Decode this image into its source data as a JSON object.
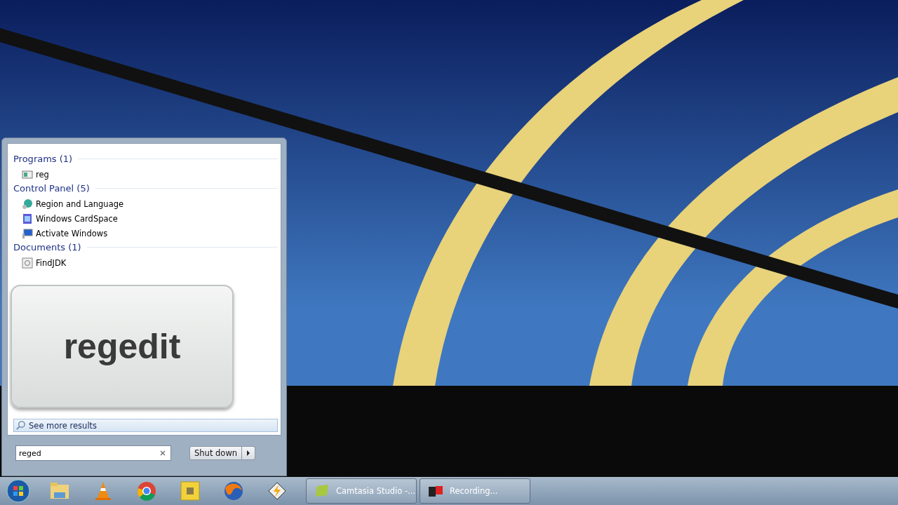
{
  "start_menu": {
    "groups": [
      {
        "heading": "Programs (1)",
        "items": [
          {
            "label": "reg",
            "kind": "program"
          }
        ]
      },
      {
        "heading": "Control Panel (5)",
        "items": [
          {
            "label": "Region and Language",
            "kind": "globe"
          },
          {
            "label": "Windows CardSpace",
            "kind": "card"
          },
          {
            "label": "Activate Windows",
            "kind": "monitor"
          }
        ]
      },
      {
        "heading": "Documents (1)",
        "items": [
          {
            "label": "FindJDK",
            "kind": "document"
          }
        ]
      }
    ],
    "see_more": "See more results",
    "search_field": {
      "value": "reged"
    },
    "shutdown_button": "Shut down"
  },
  "keystroke_overlay": "regedit",
  "taskbar": {
    "windows": [
      {
        "label": "Camtasia Studio -..."
      },
      {
        "label": "Recording..."
      }
    ]
  }
}
